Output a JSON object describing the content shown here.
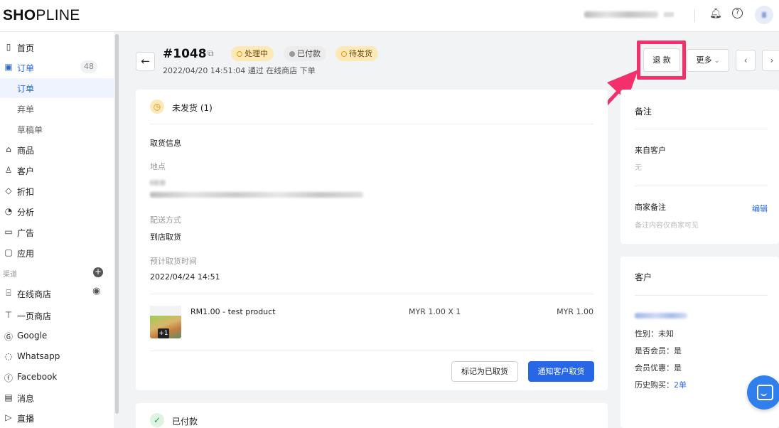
{
  "brand": {
    "logo_text": "SHOPLINE"
  },
  "topbar": {
    "bell_icon": "bell-icon",
    "help_icon": "help-icon"
  },
  "sidebar": {
    "items": [
      {
        "key": "home",
        "icon": "home-icon",
        "label": "首页"
      },
      {
        "key": "orders",
        "icon": "orders-icon",
        "label": "订单",
        "count": "48"
      },
      {
        "key": "order-list",
        "label": "订单"
      },
      {
        "key": "abandoned",
        "label": "弃单"
      },
      {
        "key": "drafts",
        "label": "草稿单"
      },
      {
        "key": "products",
        "icon": "product-icon",
        "label": "商品"
      },
      {
        "key": "customers",
        "icon": "customer-icon",
        "label": "客户"
      },
      {
        "key": "discounts",
        "icon": "discount-icon",
        "label": "折扣"
      },
      {
        "key": "analytics",
        "icon": "analytics-icon",
        "label": "分析"
      },
      {
        "key": "ads",
        "icon": "ads-icon",
        "label": "广告"
      },
      {
        "key": "apps",
        "icon": "apps-icon",
        "label": "应用"
      }
    ],
    "channels_label": "渠道",
    "channels": [
      {
        "key": "online-store",
        "label": "在线商店"
      },
      {
        "key": "one-page",
        "label": "一页商店"
      },
      {
        "key": "google",
        "label": "Google"
      },
      {
        "key": "whatsapp",
        "label": "Whatsapp"
      },
      {
        "key": "facebook",
        "label": "Facebook"
      },
      {
        "key": "messages",
        "label": "消息"
      },
      {
        "key": "live",
        "label": "直播"
      }
    ]
  },
  "order": {
    "number": "#1048",
    "tags": {
      "processing": "处理中",
      "paid": "已付款",
      "to_ship": "待发货"
    },
    "meta": "2022/04/20 14:51:04 通过 在线商店 下单"
  },
  "actions": {
    "refund": "退 款",
    "more": "更多",
    "prev": "‹",
    "next": "›"
  },
  "fulfillment": {
    "title": "未发货 (1)",
    "pickup_info": "取货信息",
    "location_label": "地点",
    "delivery_label": "配送方式",
    "delivery_value": "到店取货",
    "pickup_time_label": "预计取货时间",
    "pickup_time_value": "2022/04/24 14:51",
    "product": {
      "name": "RM1.00 - test product",
      "qty": "MYR 1.00 X 1",
      "total": "MYR 1.00",
      "extra_count": "+1"
    },
    "mark_button": "标记为已取货",
    "notify_button": "通知客户取货"
  },
  "paid_section": {
    "title": "已付款"
  },
  "notes": {
    "title": "备注",
    "from_customer_label": "来自客户",
    "from_customer_value": "无",
    "merchant_label": "商家备注",
    "edit_label": "编辑",
    "merchant_placeholder": "备注内容仅商家可见"
  },
  "customer": {
    "title": "客户",
    "gender": "性别：未知",
    "member": "是否会员：是",
    "member_discount": "会员优惠：是",
    "history_label": "历史购买：",
    "history_link": "2单"
  },
  "colors": {
    "accent": "#2766e4",
    "highlight": "#f2306c",
    "warning_tag": "#fde8b8"
  }
}
